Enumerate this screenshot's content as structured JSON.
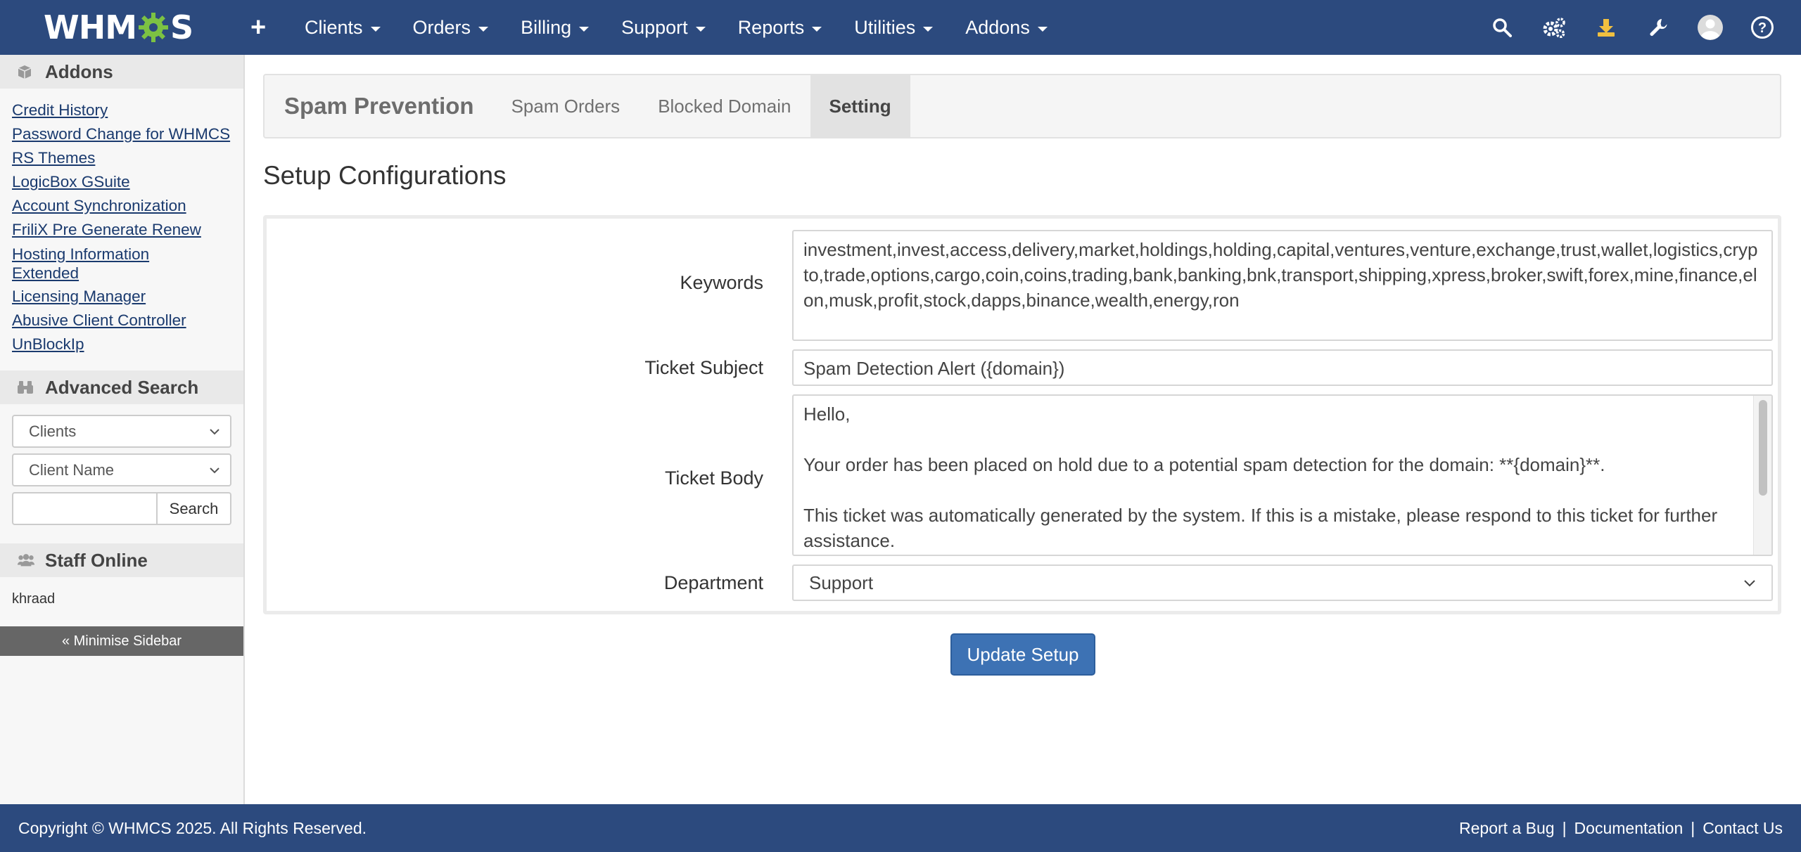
{
  "app": {
    "logo_text_left": "WHM",
    "logo_text_right": "S"
  },
  "topnav": {
    "items": [
      {
        "label": "Clients"
      },
      {
        "label": "Orders"
      },
      {
        "label": "Billing"
      },
      {
        "label": "Support"
      },
      {
        "label": "Reports"
      },
      {
        "label": "Utilities"
      },
      {
        "label": "Addons"
      }
    ],
    "right_icons": [
      "search-icon",
      "configure-icon",
      "download-icon",
      "wrench-icon",
      "avatar-icon",
      "help-icon"
    ]
  },
  "sidebar": {
    "addons_title": "Addons",
    "addon_links": [
      "Credit History",
      "Password Change for WHMCS",
      "RS Themes",
      "LogicBox GSuite",
      "Account Synchronization",
      "FriliX Pre Generate Renew",
      "Hosting Information Extended",
      "Licensing Manager",
      "Abusive Client Controller",
      "UnBlockIp"
    ],
    "advanced_search_title": "Advanced Search",
    "search_type": "Clients",
    "search_field": "Client Name",
    "search_input_value": "",
    "search_button": "Search",
    "staff_title": "Staff Online",
    "staff_name": "khraad",
    "minimise_label": "« Minimise Sidebar"
  },
  "tabs": {
    "brand": "Spam Prevention",
    "items": [
      {
        "label": "Spam Orders",
        "active": false
      },
      {
        "label": "Blocked Domain",
        "active": false
      },
      {
        "label": "Setting",
        "active": true
      }
    ]
  },
  "main": {
    "title": "Setup Configurations",
    "form": {
      "keywords_label": "Keywords",
      "keywords_value": "investment,invest,access,delivery,market,holdings,holding,capital,ventures,venture,exchange,trust,wallet,logistics,crypto,trade,options,cargo,coin,coins,trading,bank,banking,bnk,transport,shipping,xpress,broker,swift,forex,mine,finance,elon,musk,profit,stock,dapps,binance,wealth,energy,ron",
      "subject_label": "Ticket Subject",
      "subject_value": "Spam Detection Alert ({domain})",
      "body_label": "Ticket Body",
      "body_lines": [
        "Hello,",
        "Your order has been placed on hold due to a potential spam detection for the domain: **{domain}**.",
        "This ticket was automatically generated by the system. If this is a mistake, please respond to this ticket for further assistance."
      ],
      "department_label": "Department",
      "department_value": "Support"
    },
    "submit_label": "Update Setup"
  },
  "footer": {
    "copyright": "Copyright © WHMCS 2025. All Rights Reserved.",
    "links": [
      "Report a Bug",
      "Documentation",
      "Contact Us"
    ],
    "separator": "|"
  },
  "colors": {
    "navbar": "#2c4a7e",
    "accent_button": "#3d72b4",
    "logo_gear": "#7cc243",
    "download_icon": "#f0c040"
  }
}
